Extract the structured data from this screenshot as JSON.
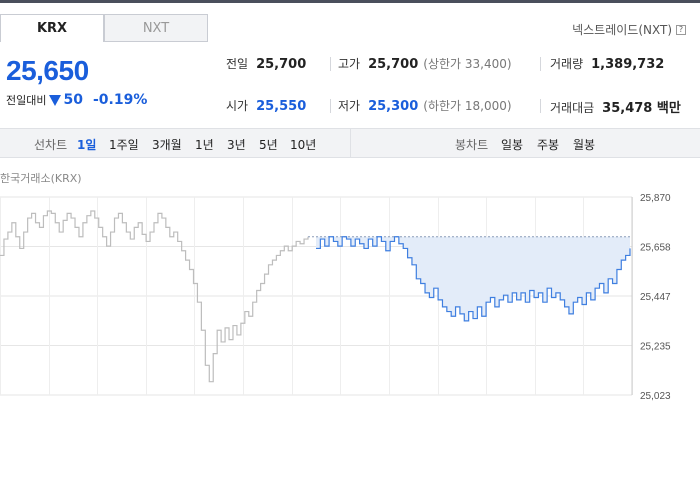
{
  "tabs": {
    "krx": "KRX",
    "nxt": "NXT"
  },
  "nxt_link": "넥스트레이드(NXT)",
  "help_icon": "?",
  "price": "25,650",
  "change": {
    "label": "전일대비",
    "amount": "50",
    "percent": "-0.19%",
    "direction": "down"
  },
  "stats": {
    "prev_close": {
      "label": "전일",
      "value": "25,700"
    },
    "high": {
      "label": "고가",
      "value": "25,700",
      "sub": "(상한가 33,400)"
    },
    "volume": {
      "label": "거래량",
      "value": "1,389,732"
    },
    "open": {
      "label": "시가",
      "value": "25,550"
    },
    "low": {
      "label": "저가",
      "value": "25,300",
      "sub": "(하한가 18,000)"
    },
    "amount": {
      "label": "거래대금",
      "value": "35,478 백만"
    }
  },
  "period_bar": {
    "line_label": "선차트",
    "line_items": [
      "1일",
      "1주일",
      "3개월",
      "1년",
      "3년",
      "5년",
      "10년"
    ],
    "active": "1일",
    "candle_label": "봉차트",
    "candle_items": [
      "일봉",
      "주봉",
      "월봉"
    ]
  },
  "chart_caption": "한국거래소(KRX)",
  "colors": {
    "up": "#e0262a",
    "down": "#1a5edb",
    "line": "#3f7fe0",
    "area": "#e3ecf9",
    "prev": "#bdbdbd"
  },
  "chart_data": {
    "type": "line",
    "title": "",
    "ylabel": "",
    "y_ticks": [
      "25,870",
      "25,658",
      "25,447",
      "25,235",
      "25,023"
    ],
    "ylim": [
      25023,
      25870
    ],
    "reference_price": 25700,
    "series": [
      {
        "values": [
          25620,
          25690,
          25720,
          25760,
          25700,
          25650,
          25720,
          25780,
          25800,
          25760,
          25740,
          25790,
          25810,
          25800,
          25760,
          25720,
          25770,
          25800,
          25780,
          25740,
          25700,
          25760,
          25790,
          25810,
          25780,
          25740,
          25700,
          25660,
          25720,
          25780,
          25800,
          25760,
          25720,
          25690,
          25740,
          25760,
          25710,
          25680,
          25720,
          25760,
          25800,
          25780,
          25740,
          25700,
          25720,
          25680,
          25640,
          25600,
          25560,
          25500,
          25420,
          25300,
          25150,
          25080,
          25200,
          25300,
          25250,
          25310,
          25260,
          25320,
          25280,
          25330,
          25380,
          25360,
          25420,
          25470,
          25500,
          25540,
          25580,
          25600,
          25620,
          25640,
          25660,
          25640,
          25660,
          25680,
          25670,
          25690,
          25700
        ]
      },
      {
        "values": [
          25650,
          25690,
          25660,
          25700,
          25680,
          25660,
          25700,
          25690,
          25660,
          25690,
          25670,
          25650,
          25690,
          25660,
          25700,
          25680,
          25640,
          25680,
          25700,
          25670,
          25650,
          25610,
          25580,
          25520,
          25500,
          25460,
          25440,
          25480,
          25430,
          25400,
          25380,
          25360,
          25400,
          25370,
          25340,
          25380,
          25350,
          25400,
          25360,
          25420,
          25440,
          25400,
          25430,
          25450,
          25420,
          25460,
          25430,
          25460,
          25420,
          25470,
          25440,
          25460,
          25420,
          25480,
          25440,
          25460,
          25430,
          25400,
          25370,
          25420,
          25440,
          25410,
          25460,
          25430,
          25480,
          25500,
          25460,
          25520,
          25500,
          25560,
          25600,
          25620,
          25650
        ]
      }
    ]
  }
}
